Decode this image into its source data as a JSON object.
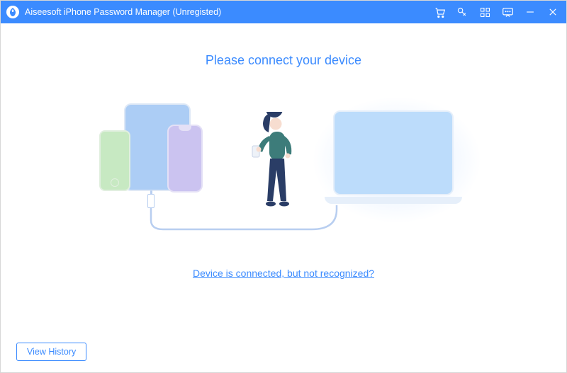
{
  "titlebar": {
    "title": "Aiseesoft iPhone Password Manager (Unregisted)",
    "icons": {
      "cart": "cart-icon",
      "key": "key-icon",
      "grid": "grid-icon",
      "feedback": "feedback-icon",
      "minimize": "minimize-icon",
      "close": "close-icon"
    }
  },
  "main": {
    "headline": "Please connect your device",
    "help_link": "Device is connected, but not recognized?"
  },
  "footer": {
    "view_history": "View History"
  },
  "colors": {
    "accent": "#3b8bff"
  }
}
